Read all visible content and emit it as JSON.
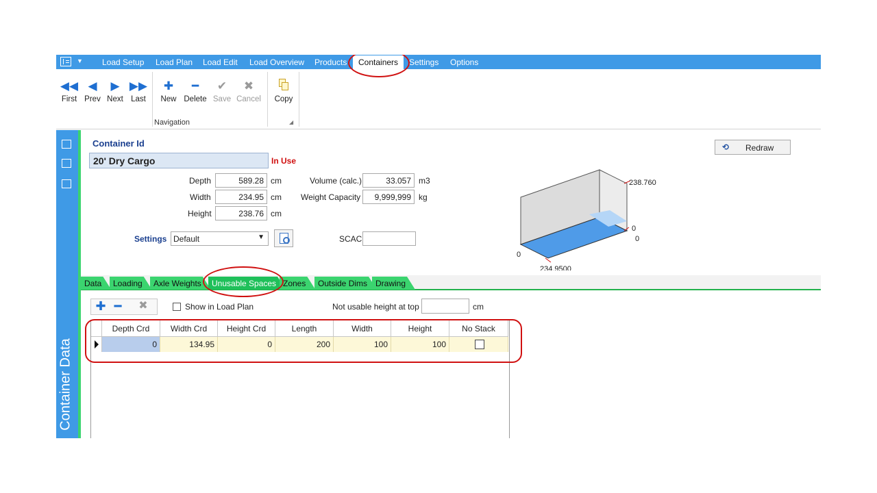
{
  "menu": {
    "items": [
      "Load Setup",
      "Load Plan",
      "Load Edit",
      "Load Overview",
      "Products",
      "Containers",
      "Settings",
      "Options"
    ],
    "active": "Containers"
  },
  "ribbon": {
    "first_label": "First",
    "prev_label": "Prev",
    "next_label": "Next",
    "last_label": "Last",
    "new_label": "New",
    "delete_label": "Delete",
    "save_label": "Save",
    "cancel_label": "Cancel",
    "copy_label": "Copy",
    "group_label": "Navigation"
  },
  "sidebar": {
    "title": "Container Data"
  },
  "form": {
    "container_id_label": "Container Id",
    "container_id_value": "20' Dry Cargo",
    "status": "In Use",
    "depth_label": "Depth",
    "depth_value": "589.28",
    "width_label": "Width",
    "width_value": "234.95",
    "height_label": "Height",
    "height_value": "238.76",
    "cm": "cm",
    "volume_label": "Volume (calc.)",
    "volume_value": "33.057",
    "volume_unit": "m3",
    "weight_label": "Weight Capacity",
    "weight_value": "9,999,999",
    "weight_unit": "kg",
    "settings_label": "Settings",
    "settings_value": "Default",
    "scac_label": "SCAC",
    "scac_value": "",
    "redraw_label": "Redraw"
  },
  "preview": {
    "height_text": "238.760",
    "zero_a": "0",
    "zero_b": "0",
    "zero_c": "0",
    "width_text": "234.9500"
  },
  "tabs": [
    "Data",
    "Loading",
    "Axle Weights",
    "Unusable Spaces",
    "Zones",
    "Outside Dims",
    "Drawing"
  ],
  "active_tab": "Unusable Spaces",
  "unusable": {
    "show_in_load_plan": "Show in Load Plan",
    "not_usable_label": "Not usable height at top",
    "not_usable_value": "",
    "unit": "cm",
    "columns": [
      "Depth Crd",
      "Width Crd",
      "Height Crd",
      "Length",
      "Width",
      "Height",
      "No Stack"
    ],
    "rows": [
      {
        "depth_crd": "0",
        "width_crd": "134.95",
        "height_crd": "0",
        "length": "200",
        "width": "100",
        "height": "100"
      }
    ]
  },
  "colors": {
    "accent": "#3f9ae6",
    "tab_green": "#3bd46f",
    "annotation": "#d01010"
  }
}
